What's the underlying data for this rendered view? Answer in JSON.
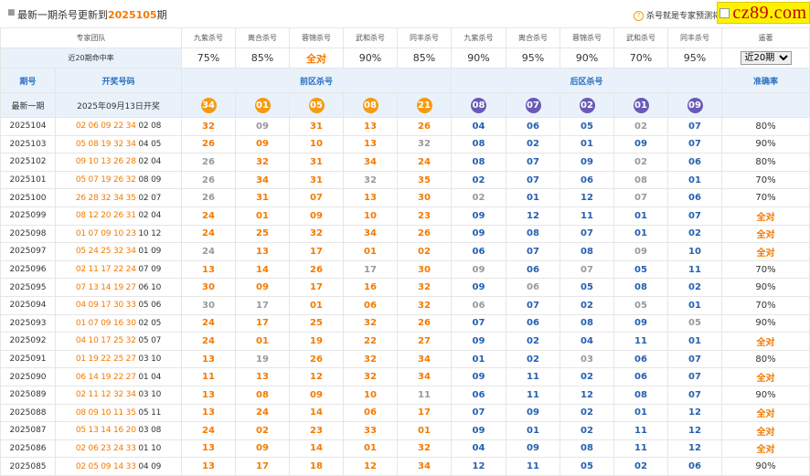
{
  "header": {
    "title_prefix": "最新一期杀号更新到",
    "issue": "2025105",
    "title_suffix": "期",
    "note": "杀号就是专家预测将"
  },
  "brand": {
    "text": "cz89.com"
  },
  "table": {
    "team_label": "专家团队",
    "experts": [
      "九紫杀号",
      "离合杀号",
      "蓉锦杀号",
      "武和杀号",
      "同丰杀号",
      "九紫杀号",
      "离合杀号",
      "蓉锦杀号",
      "武和杀号",
      "同丰杀号"
    ],
    "rank_label": "遥著",
    "rate_label": "近20期命中率",
    "rates": [
      "75%",
      "85%",
      "全对",
      "90%",
      "85%",
      "90%",
      "95%",
      "90%",
      "70%",
      "95%"
    ],
    "period_select": "近20期",
    "col_issue": "期号",
    "col_nums": "开奖号码",
    "front_label": "前区杀号",
    "back_label": "后区杀号",
    "accuracy_label": "准确率",
    "latest_label": "最新一期",
    "latest_date": "2025年09月13日开奖",
    "latest_front": [
      "34",
      "01",
      "05",
      "08",
      "21"
    ],
    "latest_back": [
      "08",
      "07",
      "02",
      "01",
      "09"
    ]
  },
  "rows": [
    {
      "issue": "2025104",
      "front": "02 06 09 22 34",
      "back": "02 08",
      "kf": [
        "32",
        "09",
        "31",
        "13",
        "26"
      ],
      "kb": [
        "04",
        "06",
        "05",
        "02",
        "07"
      ],
      "acc": "80%"
    },
    {
      "issue": "2025103",
      "front": "05 08 19 32 34",
      "back": "04 05",
      "kf": [
        "26",
        "09",
        "10",
        "13",
        "32"
      ],
      "kb": [
        "08",
        "02",
        "01",
        "09",
        "07"
      ],
      "acc": "90%"
    },
    {
      "issue": "2025102",
      "front": "09 10 13 26 28",
      "back": "02 04",
      "kf": [
        "26",
        "32",
        "31",
        "34",
        "24"
      ],
      "kb": [
        "08",
        "07",
        "09",
        "02",
        "06"
      ],
      "acc": "80%"
    },
    {
      "issue": "2025101",
      "front": "05 07 19 26 32",
      "back": "08 09",
      "kf": [
        "26",
        "34",
        "31",
        "32",
        "35"
      ],
      "kb": [
        "02",
        "07",
        "06",
        "08",
        "01"
      ],
      "acc": "70%"
    },
    {
      "issue": "2025100",
      "front": "26 28 32 34 35",
      "back": "02 07",
      "kf": [
        "26",
        "31",
        "07",
        "13",
        "30"
      ],
      "kb": [
        "02",
        "01",
        "12",
        "07",
        "06"
      ],
      "acc": "70%"
    },
    {
      "issue": "2025099",
      "front": "08 12 20 26 31",
      "back": "02 04",
      "kf": [
        "24",
        "01",
        "09",
        "10",
        "23"
      ],
      "kb": [
        "09",
        "12",
        "11",
        "01",
        "07"
      ],
      "acc": "全对"
    },
    {
      "issue": "2025098",
      "front": "01 07 09 10 23",
      "back": "10 12",
      "kf": [
        "24",
        "25",
        "32",
        "34",
        "26"
      ],
      "kb": [
        "09",
        "08",
        "07",
        "01",
        "02"
      ],
      "acc": "全对"
    },
    {
      "issue": "2025097",
      "front": "05 24 25 32 34",
      "back": "01 09",
      "kf": [
        "24",
        "13",
        "17",
        "01",
        "02"
      ],
      "kb": [
        "06",
        "07",
        "08",
        "09",
        "10"
      ],
      "acc": "全对"
    },
    {
      "issue": "2025096",
      "front": "02 11 17 22 24",
      "back": "07 09",
      "kf": [
        "13",
        "14",
        "26",
        "17",
        "30"
      ],
      "kb": [
        "09",
        "06",
        "07",
        "05",
        "11"
      ],
      "acc": "70%"
    },
    {
      "issue": "2025095",
      "front": "07 13 14 19 27",
      "back": "06 10",
      "kf": [
        "30",
        "09",
        "17",
        "16",
        "32"
      ],
      "kb": [
        "09",
        "06",
        "05",
        "08",
        "02"
      ],
      "acc": "90%"
    },
    {
      "issue": "2025094",
      "front": "04 09 17 30 33",
      "back": "05 06",
      "kf": [
        "30",
        "17",
        "01",
        "06",
        "32"
      ],
      "kb": [
        "06",
        "07",
        "02",
        "05",
        "01"
      ],
      "acc": "70%"
    },
    {
      "issue": "2025093",
      "front": "01 07 09 16 30",
      "back": "02 05",
      "kf": [
        "24",
        "17",
        "25",
        "32",
        "26"
      ],
      "kb": [
        "07",
        "06",
        "08",
        "09",
        "05"
      ],
      "acc": "90%"
    },
    {
      "issue": "2025092",
      "front": "04 10 17 25 32",
      "back": "05 07",
      "kf": [
        "24",
        "01",
        "19",
        "22",
        "27"
      ],
      "kb": [
        "09",
        "02",
        "04",
        "11",
        "01"
      ],
      "acc": "全对"
    },
    {
      "issue": "2025091",
      "front": "01 19 22 25 27",
      "back": "03 10",
      "kf": [
        "13",
        "19",
        "26",
        "32",
        "34"
      ],
      "kb": [
        "01",
        "02",
        "03",
        "06",
        "07"
      ],
      "acc": "80%"
    },
    {
      "issue": "2025090",
      "front": "06 14 19 22 27",
      "back": "01 04",
      "kf": [
        "11",
        "13",
        "12",
        "32",
        "34"
      ],
      "kb": [
        "09",
        "11",
        "02",
        "06",
        "07"
      ],
      "acc": "全对"
    },
    {
      "issue": "2025089",
      "front": "02 11 12 32 34",
      "back": "03 10",
      "kf": [
        "13",
        "08",
        "09",
        "10",
        "11"
      ],
      "kb": [
        "06",
        "11",
        "12",
        "08",
        "07"
      ],
      "acc": "90%"
    },
    {
      "issue": "2025088",
      "front": "08 09 10 11 35",
      "back": "05 11",
      "kf": [
        "13",
        "24",
        "14",
        "06",
        "17"
      ],
      "kb": [
        "07",
        "09",
        "02",
        "01",
        "12"
      ],
      "acc": "全对"
    },
    {
      "issue": "2025087",
      "front": "05 13 14 16 20",
      "back": "03 08",
      "kf": [
        "24",
        "02",
        "23",
        "33",
        "01"
      ],
      "kb": [
        "09",
        "01",
        "02",
        "11",
        "12"
      ],
      "acc": "全对"
    },
    {
      "issue": "2025086",
      "front": "02 06 23 24 33",
      "back": "01 10",
      "kf": [
        "13",
        "09",
        "14",
        "01",
        "32"
      ],
      "kb": [
        "04",
        "09",
        "08",
        "11",
        "12"
      ],
      "acc": "全对"
    },
    {
      "issue": "2025085",
      "front": "02 05 09 14 33",
      "back": "04 09",
      "kf": [
        "13",
        "17",
        "18",
        "12",
        "34"
      ],
      "kb": [
        "12",
        "11",
        "05",
        "02",
        "06"
      ],
      "acc": "90%"
    }
  ]
}
